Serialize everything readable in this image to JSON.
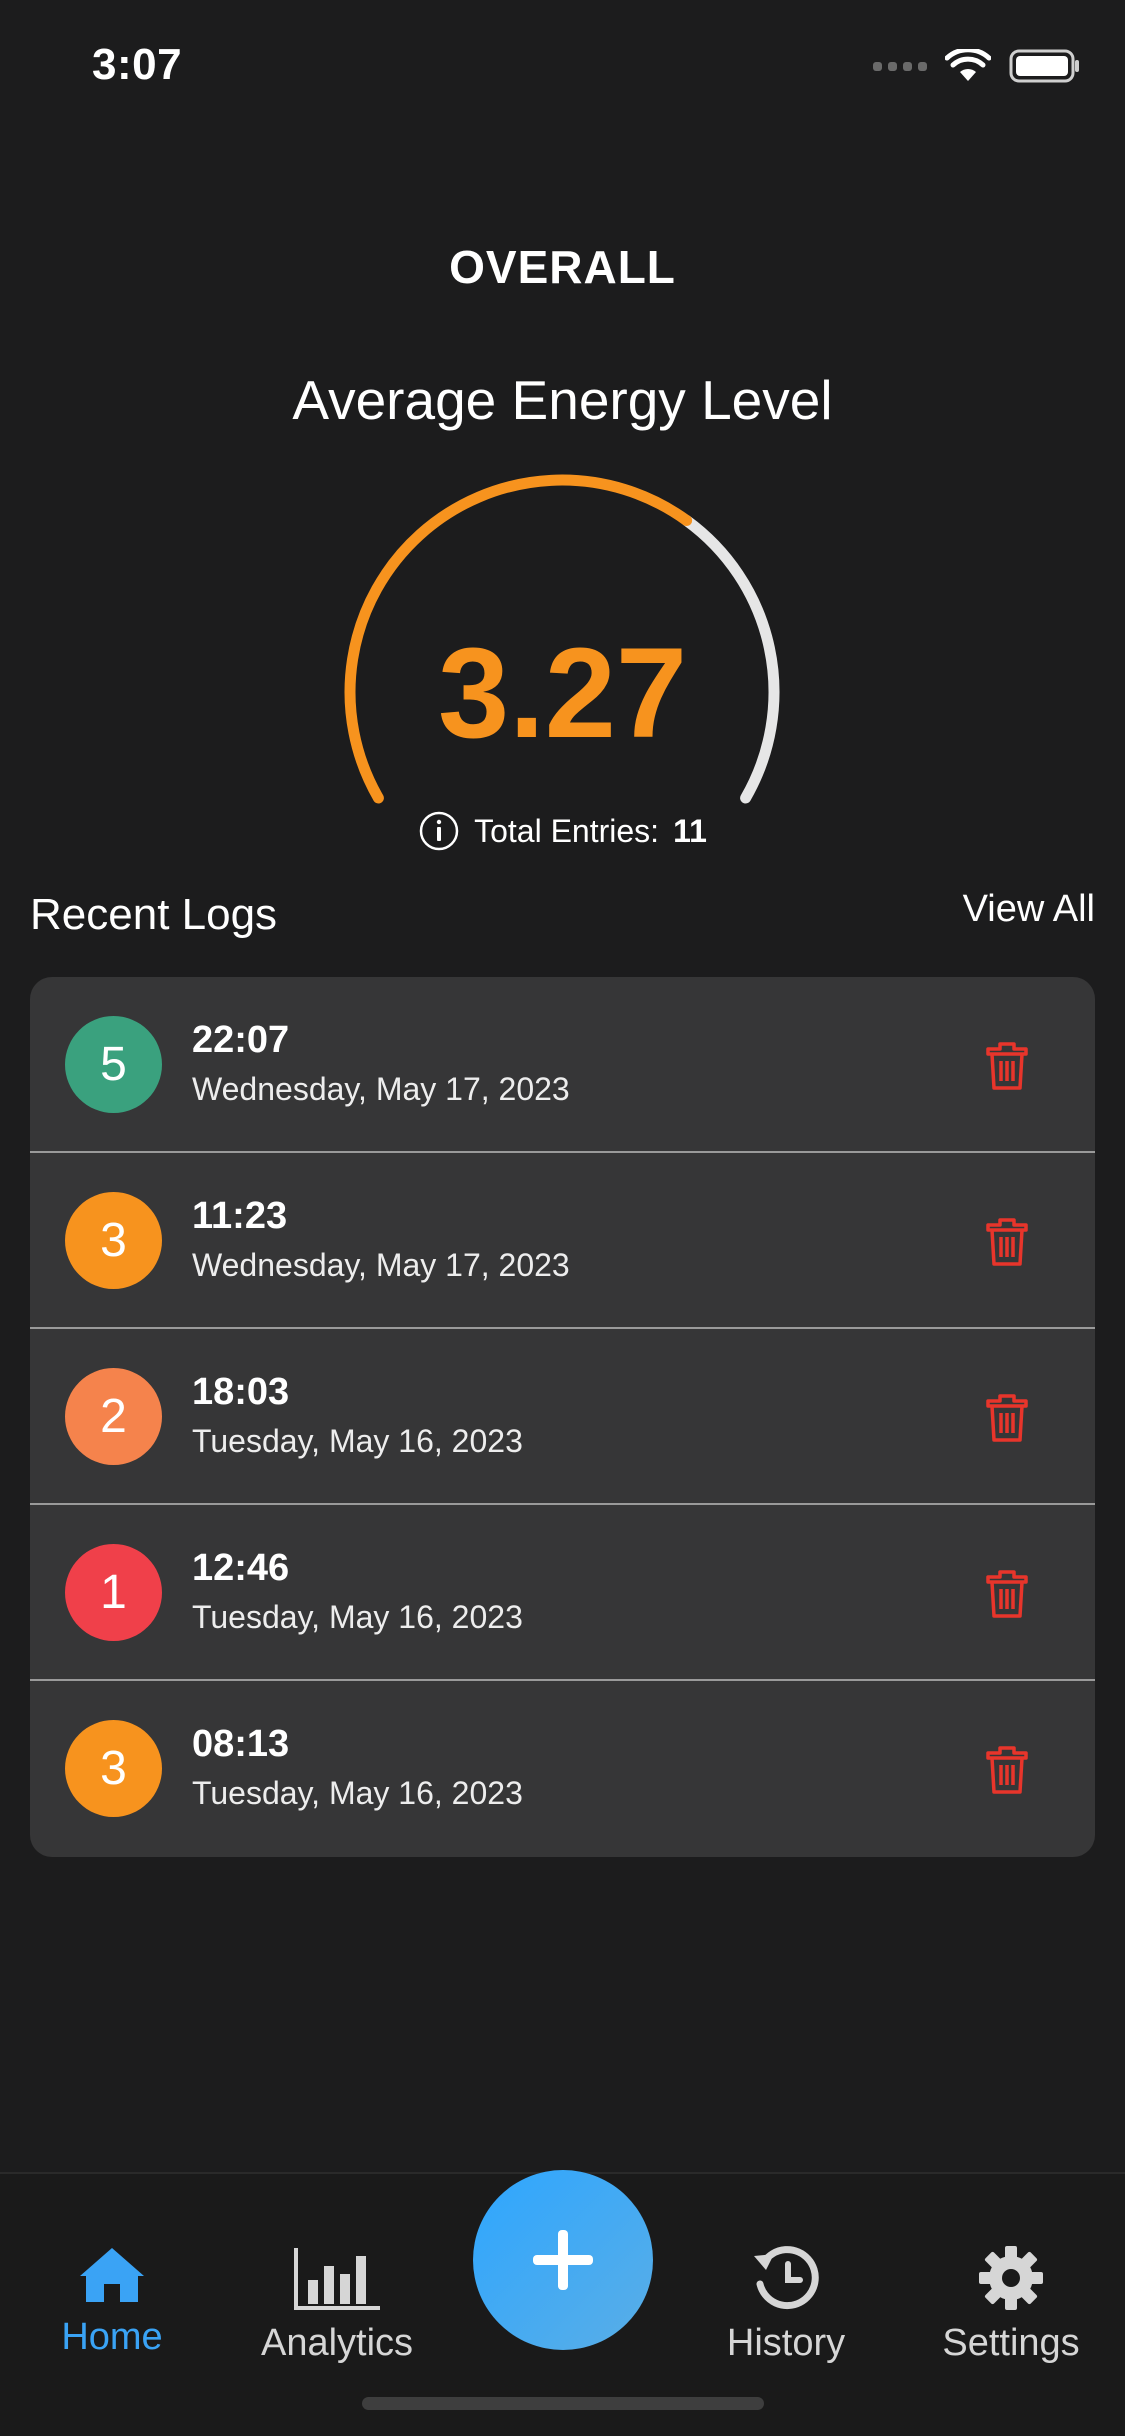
{
  "status_bar": {
    "time": "3:07"
  },
  "header": {
    "title": "OVERALL"
  },
  "gauge": {
    "title": "Average Energy Level",
    "value": "3.27",
    "fill_fraction": 0.65,
    "entries_label": "Total Entries:",
    "entries_count": "11",
    "colors": {
      "fill": "#f7931e",
      "track": "#e6e6e6"
    }
  },
  "recent_logs": {
    "title": "Recent Logs",
    "view_all": "View All",
    "items": [
      {
        "level": "5",
        "time": "22:07",
        "date": "Wednesday, May 17, 2023",
        "color": "#3aa17e"
      },
      {
        "level": "3",
        "time": "11:23",
        "date": "Wednesday, May 17, 2023",
        "color": "#f7931e"
      },
      {
        "level": "2",
        "time": "18:03",
        "date": "Tuesday, May 16, 2023",
        "color": "#f5834c"
      },
      {
        "level": "1",
        "time": "12:46",
        "date": "Tuesday, May 16, 2023",
        "color": "#f0404a"
      },
      {
        "level": "3",
        "time": "08:13",
        "date": "Tuesday, May 16, 2023",
        "color": "#f7931e"
      }
    ]
  },
  "tabbar": {
    "home": "Home",
    "analytics": "Analytics",
    "history": "History",
    "settings": "Settings",
    "active_color": "#3aa3f5"
  }
}
